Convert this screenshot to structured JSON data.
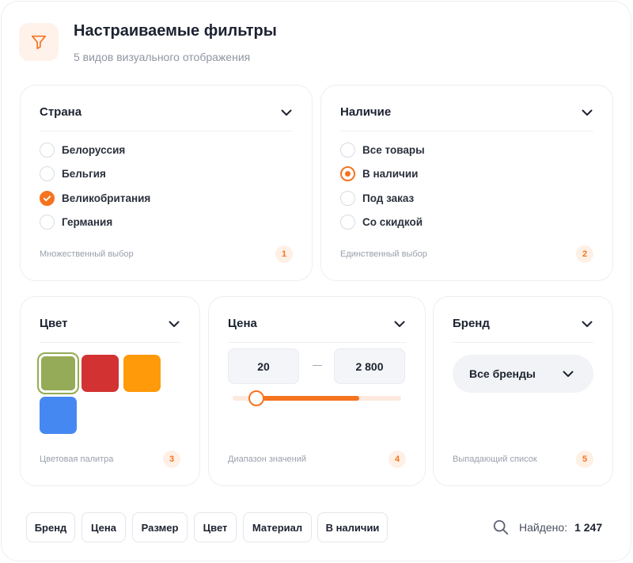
{
  "header": {
    "title": "Настраиваемые фильтры",
    "subtitle": "5 видов визуального отображения",
    "icon": "funnel-icon",
    "accent": "#f5741f"
  },
  "cards": {
    "country": {
      "title": "Страна",
      "options": [
        {
          "label": "Белоруссия",
          "checked": false
        },
        {
          "label": "Бельгия",
          "checked": false
        },
        {
          "label": "Великобритания",
          "checked": true
        },
        {
          "label": "Германия",
          "checked": false
        }
      ],
      "footer": "Множественный выбор",
      "badge": "1"
    },
    "availability": {
      "title": "Наличие",
      "options": [
        {
          "label": "Все товары",
          "selected": false
        },
        {
          "label": "В наличии",
          "selected": true
        },
        {
          "label": "Под заказ",
          "selected": false
        },
        {
          "label": "Со скидкой",
          "selected": false
        }
      ],
      "footer": "Единственный выбор",
      "badge": "2"
    },
    "color": {
      "title": "Цвет",
      "swatches": [
        {
          "color": "#96ab57",
          "selected": true
        },
        {
          "color": "#d23232",
          "selected": false
        },
        {
          "color": "#ff9a0a",
          "selected": false
        },
        {
          "color": "#4688f2",
          "selected": false
        }
      ],
      "footer": "Цветовая палитра",
      "badge": "3"
    },
    "price": {
      "title": "Цена",
      "min": "20",
      "max": "2 800",
      "footer": "Диапазон значений",
      "badge": "4"
    },
    "brand": {
      "title": "Бренд",
      "dropdown_value": "Все бренды",
      "footer": "Выпадающий список",
      "badge": "5"
    }
  },
  "chips": [
    "Бренд",
    "Цена",
    "Размер",
    "Цвет",
    "Материал",
    "В наличии"
  ],
  "results": {
    "label": "Найдено:",
    "count": "1 247",
    "icon": "search-icon"
  }
}
